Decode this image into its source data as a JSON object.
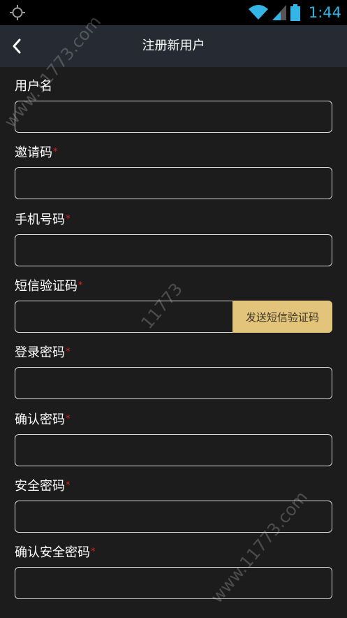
{
  "status": {
    "time": "1:44"
  },
  "nav": {
    "title": "注册新用户"
  },
  "fields": [
    {
      "label": "用户名",
      "required": "",
      "value": ""
    },
    {
      "label": "邀请码",
      "required": "*",
      "value": ""
    },
    {
      "label": "手机号码",
      "required": "*",
      "value": ""
    },
    {
      "label": "短信验证码",
      "required": "*",
      "value": ""
    },
    {
      "label": "登录密码",
      "required": "*",
      "value": ""
    },
    {
      "label": "确认密码",
      "required": "*",
      "value": ""
    },
    {
      "label": "安全密码",
      "required": "*",
      "value": ""
    },
    {
      "label": "确认安全密码",
      "required": "*",
      "value": ""
    }
  ],
  "sms_button": "发送短信验证码",
  "watermarks": [
    "www.11773.com",
    "11773",
    "www.11773.com"
  ],
  "colors": {
    "accent": "#e2c57a",
    "required": "#e02020",
    "status_time": "#33b5e5"
  }
}
